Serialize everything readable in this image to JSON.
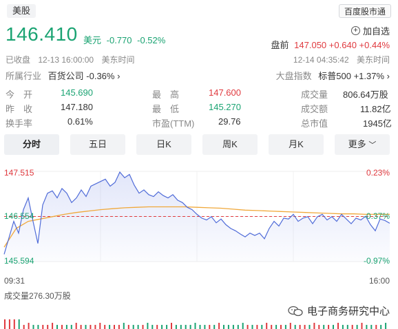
{
  "header": {
    "market_tag": "美股",
    "source_tag": "百度股市通"
  },
  "quote": {
    "price": "146.410",
    "currency": "美元",
    "change": "-0.770",
    "change_pct": "-0.52%",
    "watch_label": "加自选",
    "premarket_label": "盘前",
    "premarket_price": "147.050",
    "premarket_change": "+0.640",
    "premarket_pct": "+0.44%",
    "closed_status": "已收盘",
    "closed_time": "12-13 16:00:00",
    "closed_tz": "美东时间",
    "premarket_time": "12-14 04:35:42",
    "premarket_tz": "美东时间"
  },
  "industry": {
    "label": "所属行业",
    "name": "百货公司",
    "change": "-0.36%"
  },
  "index": {
    "label": "大盘指数",
    "name": "标普500",
    "change": "+1.37%"
  },
  "stats": {
    "open_label": "今　开",
    "open": "145.690",
    "prev_close_label": "昨　收",
    "prev_close": "147.180",
    "turnover_label": "换手率",
    "turnover": "0.61%",
    "high_label": "最　高",
    "high": "147.600",
    "low_label": "最　低",
    "low": "145.270",
    "pe_label": "市盈(TTM)",
    "pe": "29.76",
    "volume_label": "成交量",
    "volume": "806.64万股",
    "amount_label": "成交额",
    "amount": "11.82亿",
    "mcap_label": "总市值",
    "mcap": "1945亿"
  },
  "tabs": [
    "分时",
    "五日",
    "日K",
    "周K",
    "月K",
    "更多"
  ],
  "chart_labels": {
    "y_top": "147.515",
    "y_mid": "146.554",
    "y_bottom": "145.594",
    "pct_top": "0.23%",
    "pct_mid": "-0.37%",
    "pct_bottom": "-0.97%",
    "time_start": "09:31",
    "time_end": "16:00",
    "volume_text": "成交量276.30万股"
  },
  "watermark": "电子商务研究中心",
  "colors": {
    "up": "#e0393e",
    "down": "#1aa372",
    "price_line": "#4f6bd8",
    "avg_line": "#f0a83a",
    "ref_line": "#e0393e"
  },
  "chart_data": {
    "type": "line",
    "x": [
      "09:31",
      "16:00"
    ],
    "ylim": [
      145.594,
      147.515
    ],
    "reference": 146.554,
    "series": [
      {
        "values": [
          145.75,
          146.1,
          146.45,
          146.2,
          146.7,
          146.95,
          146.45,
          145.98,
          146.8,
          147.05,
          147.1,
          146.95,
          147.15,
          147.05,
          146.85,
          146.95,
          147.12,
          146.98,
          147.2,
          147.25,
          147.3,
          147.35,
          147.2,
          147.28,
          147.5,
          147.38,
          147.45,
          147.22,
          147.05,
          147.12,
          147.02,
          146.98,
          147.08,
          147.0,
          146.95,
          147.02,
          146.9,
          146.85,
          146.75,
          146.7,
          146.6,
          146.52,
          146.48,
          146.55,
          146.42,
          146.5,
          146.38,
          146.3,
          146.25,
          146.18,
          146.12,
          146.2,
          146.15,
          146.2,
          146.08,
          146.3,
          146.45,
          146.35,
          146.52,
          146.5,
          146.6,
          146.45,
          146.52,
          146.55,
          146.4,
          146.55,
          146.6,
          146.48,
          146.55,
          146.45,
          146.6,
          146.5,
          146.4,
          146.52,
          146.48,
          146.56,
          146.38,
          146.25,
          146.5,
          146.47,
          146.41
        ]
      },
      {
        "values": [
          145.9,
          146.3,
          146.45,
          146.5,
          146.55,
          146.6,
          146.64,
          146.67,
          146.7,
          146.72,
          146.74,
          146.75,
          146.76,
          146.76,
          146.76,
          146.76,
          146.75,
          146.74,
          146.73,
          146.71,
          146.69,
          146.68,
          146.67,
          146.66,
          146.65,
          146.64,
          146.63,
          146.62,
          146.61,
          146.61,
          146.6,
          146.6,
          146.6
        ]
      }
    ]
  }
}
